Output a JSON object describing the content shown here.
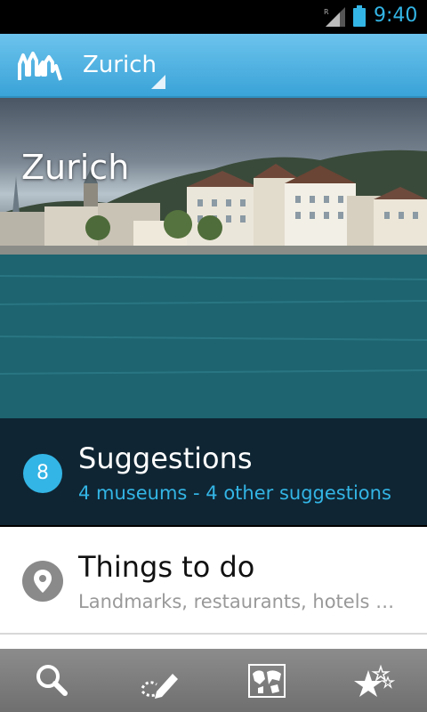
{
  "status_bar": {
    "signal_icon": "signal-roaming-icon",
    "battery_icon": "battery-icon",
    "time": "9:40",
    "accent": "#33b5e5"
  },
  "action_bar": {
    "logo_icon": "skyline-logo-icon",
    "city": "Zurich"
  },
  "hero": {
    "title": "Zurich"
  },
  "suggestions": {
    "count": "8",
    "title": "Suggestions",
    "subtitle": "4 museums - 4 other suggestions"
  },
  "things_to_do": {
    "icon": "location-pin-icon",
    "title": "Things to do",
    "subtitle": "Landmarks, restaurants, hotels …"
  },
  "tab_bar": {
    "tabs": [
      {
        "icon": "search-icon"
      },
      {
        "icon": "plan-pen-icon"
      },
      {
        "icon": "map-icon",
        "selected": true
      },
      {
        "icon": "favorites-stars-icon"
      }
    ]
  }
}
